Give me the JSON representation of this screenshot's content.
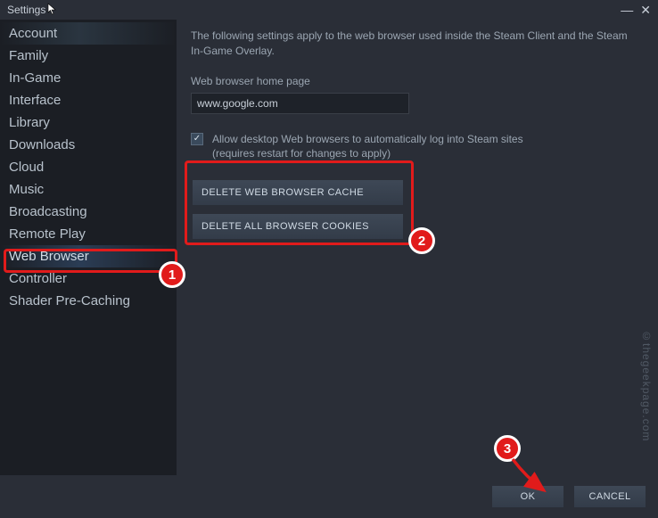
{
  "window": {
    "title": "Settings"
  },
  "sidebar": {
    "items": [
      {
        "label": "Account"
      },
      {
        "label": "Family"
      },
      {
        "label": "In-Game"
      },
      {
        "label": "Interface"
      },
      {
        "label": "Library"
      },
      {
        "label": "Downloads"
      },
      {
        "label": "Cloud"
      },
      {
        "label": "Music"
      },
      {
        "label": "Broadcasting"
      },
      {
        "label": "Remote Play"
      },
      {
        "label": "Web Browser"
      },
      {
        "label": "Controller"
      },
      {
        "label": "Shader Pre-Caching"
      }
    ],
    "selected_index": 10
  },
  "content": {
    "description": "The following settings apply to the web browser used inside the Steam Client and the Steam In-Game Overlay.",
    "homepage_label": "Web browser home page",
    "homepage_value": "www.google.com",
    "checkbox_checked": true,
    "checkbox_text_line1": "Allow desktop Web browsers to automatically log into Steam sites",
    "checkbox_text_line2": "(requires restart for changes to apply)",
    "btn_delete_cache": "DELETE WEB BROWSER CACHE",
    "btn_delete_cookies": "DELETE ALL BROWSER COOKIES"
  },
  "footer": {
    "ok": "OK",
    "cancel": "CANCEL"
  },
  "annotations": {
    "badge1": "1",
    "badge2": "2",
    "badge3": "3",
    "watermark": "©thegeekpage.com"
  }
}
